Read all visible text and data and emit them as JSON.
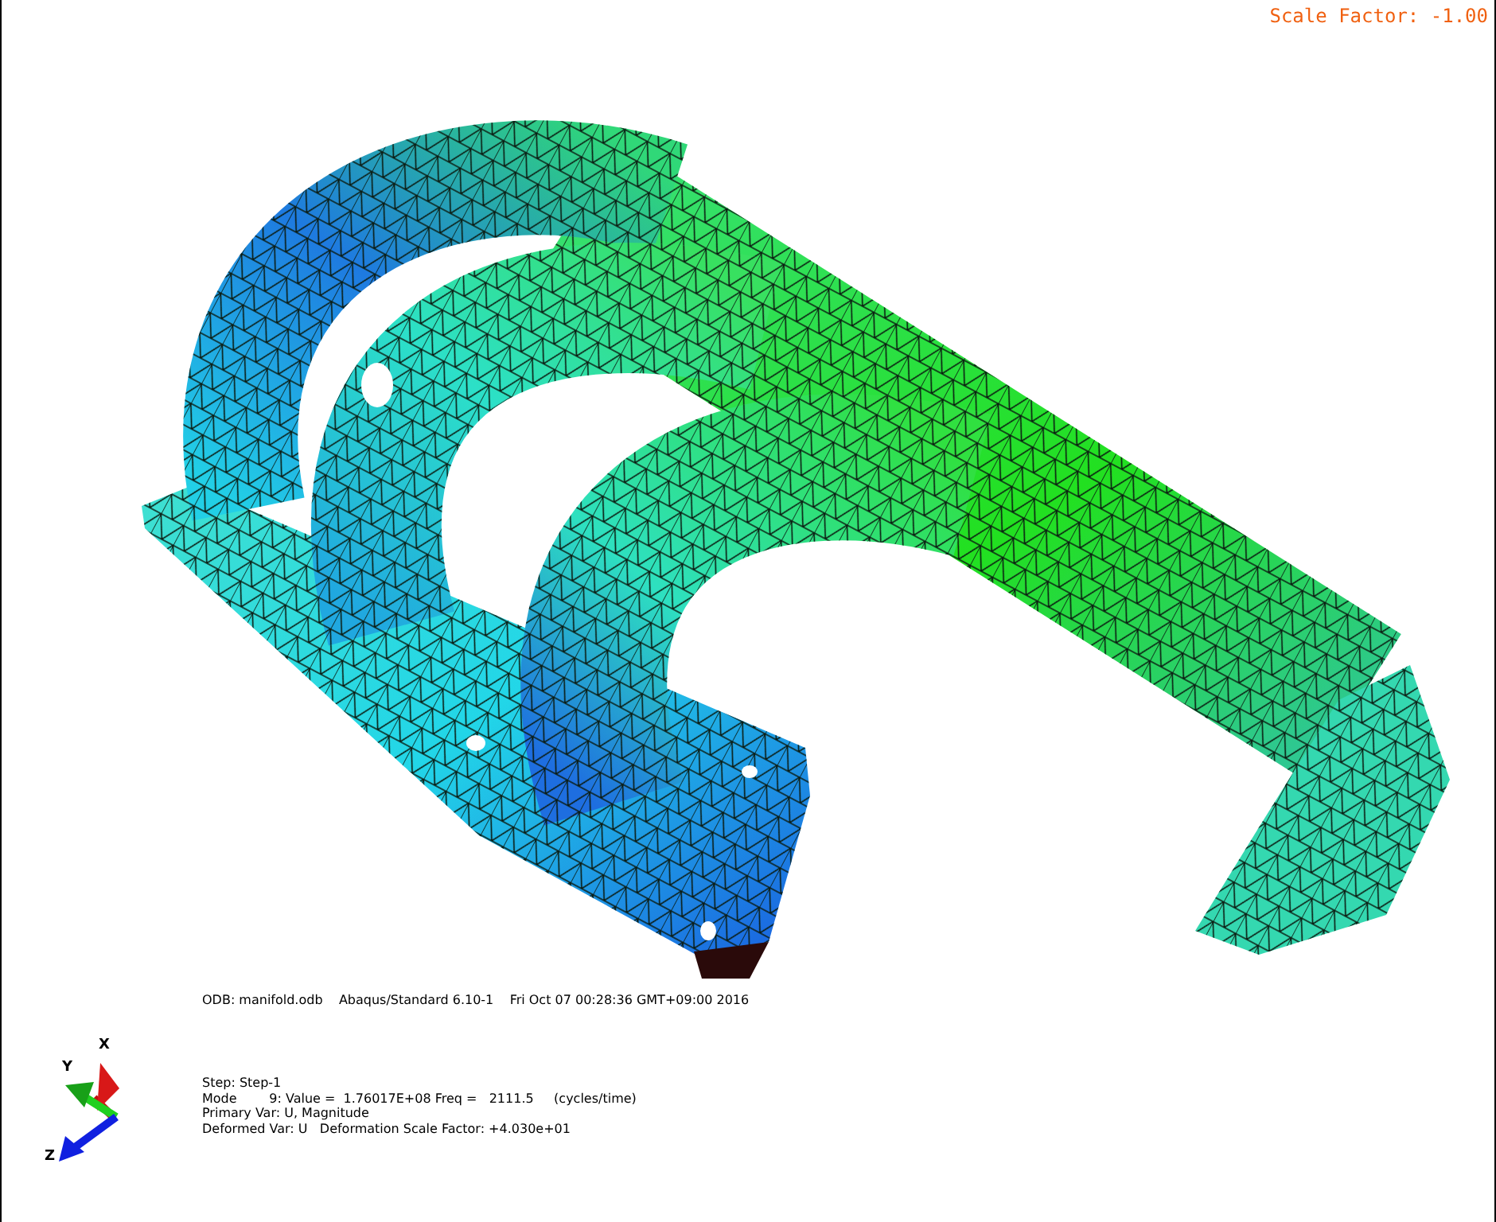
{
  "viewport": {
    "scale_factor": "Scale Factor: -1.00",
    "odb_line": "ODB: manifold.odb    Abaqus/Standard 6.10-1    Fri Oct 07 00:28:36 GMT+09:00 2016",
    "info_lines": [
      "Step: Step-1",
      "Mode        9: Value =  1.76017E+08 Freq =   2111.5     (cycles/time)",
      "Primary Var: U, Magnitude",
      "Deformed Var: U   Deformation Scale Factor: +4.030e+01"
    ],
    "triad": {
      "x": "X",
      "y": "Y",
      "z": "Z"
    }
  }
}
